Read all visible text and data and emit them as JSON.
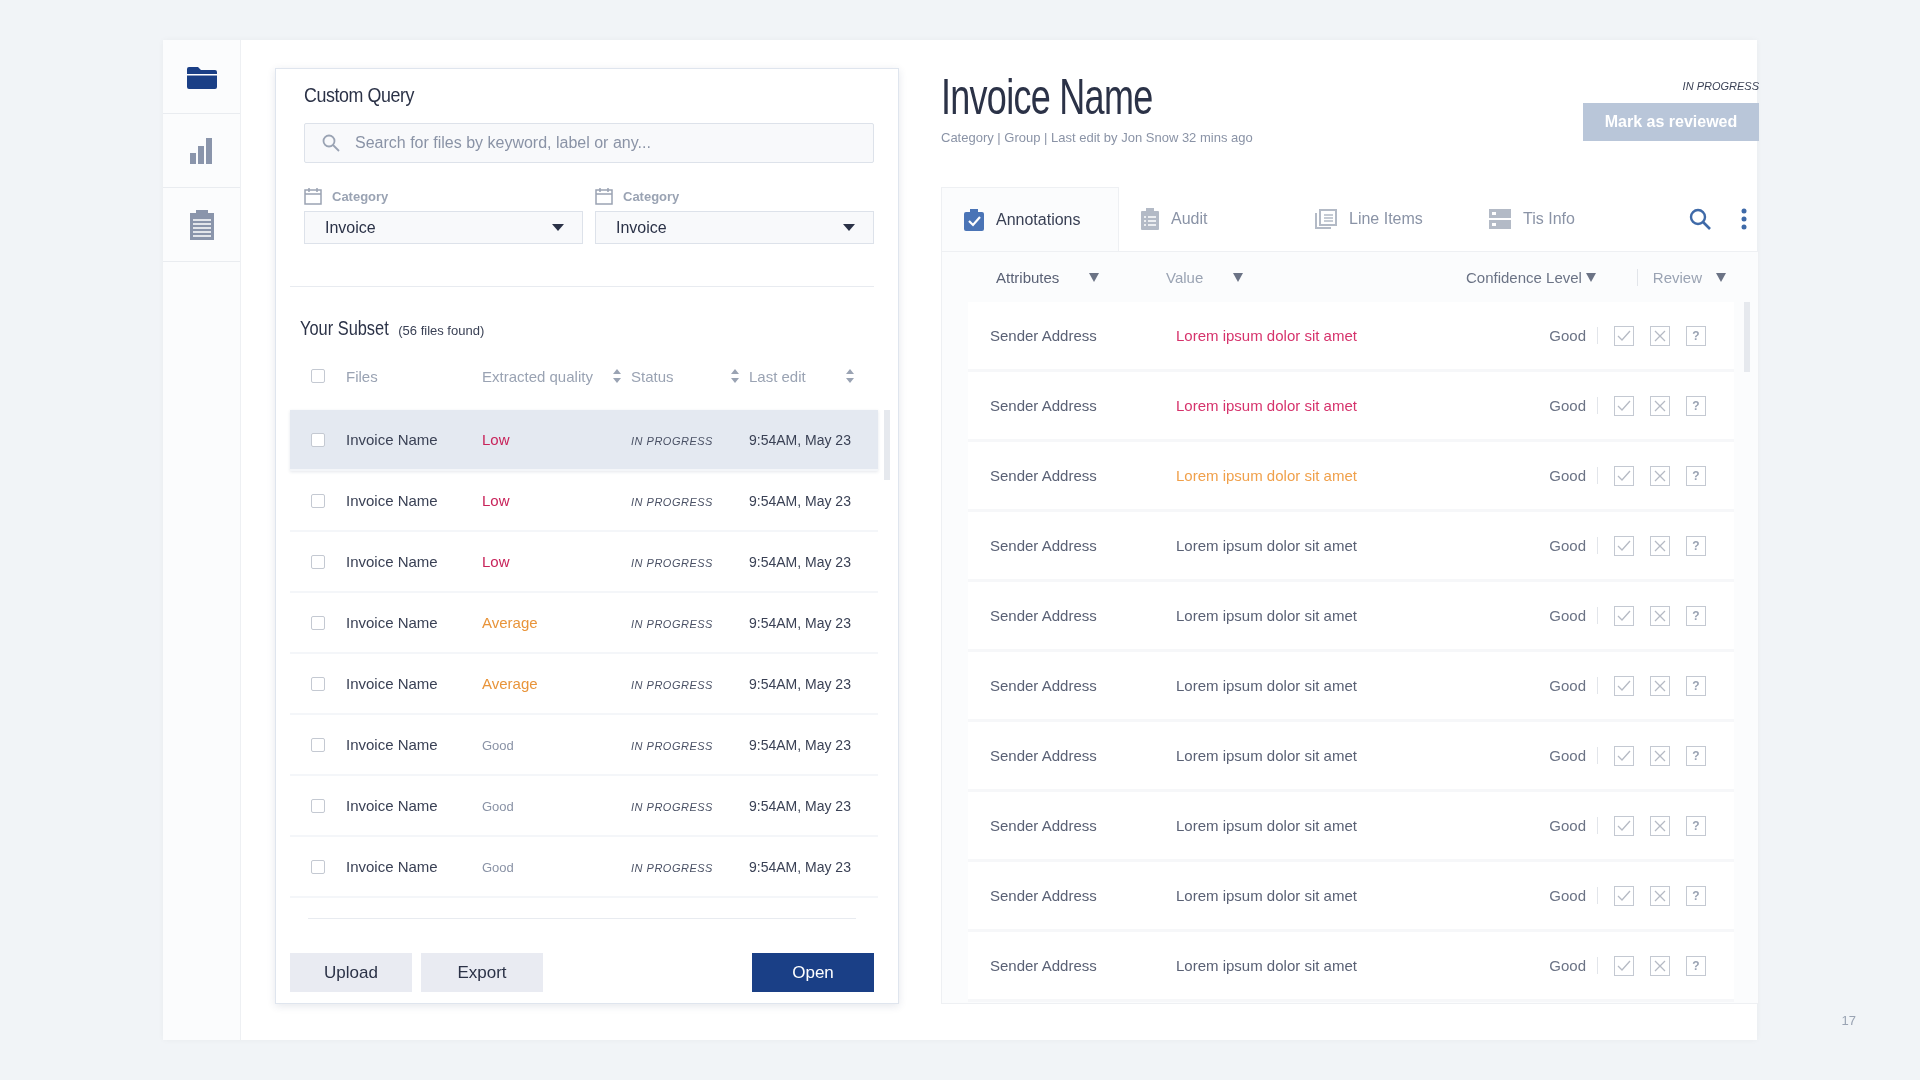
{
  "nav": [
    {
      "kind": "folder",
      "selected": true
    },
    {
      "kind": "chart",
      "selected": false
    },
    {
      "kind": "clipboard",
      "selected": false
    }
  ],
  "query": {
    "title": "Custom Query",
    "search": {
      "placeholder": "Search for files by keyword, label or any..."
    },
    "filters": [
      {
        "label": "Category",
        "value": "Invoice"
      },
      {
        "label": "Category",
        "value": "Invoice"
      }
    ]
  },
  "subset": {
    "title": "Your Subset",
    "count": "(56 files found)",
    "columns": [
      "Files",
      "Extracted quality",
      "Status",
      "Last edit"
    ],
    "select_all": {
      "checked": false
    },
    "rows": [
      {
        "name": "Invoice Name",
        "quality": "Low",
        "kind": "low",
        "status": "IN PROGRESS",
        "last_edit": "9:54AM, May 23",
        "checked": false,
        "selected": true
      },
      {
        "name": "Invoice Name",
        "quality": "Low",
        "kind": "low",
        "status": "IN PROGRESS",
        "last_edit": "9:54AM, May 23",
        "checked": false,
        "selected": false
      },
      {
        "name": "Invoice Name",
        "quality": "Low",
        "kind": "low",
        "status": "IN PROGRESS",
        "last_edit": "9:54AM, May 23",
        "checked": false,
        "selected": false
      },
      {
        "name": "Invoice Name",
        "quality": "Average",
        "kind": "average",
        "status": "IN PROGRESS",
        "last_edit": "9:54AM, May 23",
        "checked": false,
        "selected": false
      },
      {
        "name": "Invoice Name",
        "quality": "Average",
        "kind": "average",
        "status": "IN PROGRESS",
        "last_edit": "9:54AM, May 23",
        "checked": false,
        "selected": false
      },
      {
        "name": "Invoice Name",
        "quality": "Good",
        "kind": "good",
        "status": "IN PROGRESS",
        "last_edit": "9:54AM, May 23",
        "checked": false,
        "selected": false
      },
      {
        "name": "Invoice Name",
        "quality": "Good",
        "kind": "good",
        "status": "IN PROGRESS",
        "last_edit": "9:54AM, May 23",
        "checked": false,
        "selected": false
      },
      {
        "name": "Invoice Name",
        "quality": "Good",
        "kind": "good",
        "status": "IN PROGRESS",
        "last_edit": "9:54AM, May 23",
        "checked": false,
        "selected": false
      }
    ],
    "buttons": [
      {
        "label": "Upload",
        "kind": "secondary"
      },
      {
        "label": "Export",
        "kind": "secondary"
      },
      {
        "label": "Open",
        "kind": "primary"
      }
    ]
  },
  "detail": {
    "title": "Invoice Name",
    "meta": "Category | Group | Last edit by Jon Snow 32 mins ago",
    "status": "IN PROGRESS",
    "action": {
      "label": "Mark as reviewed",
      "disabled": true
    }
  },
  "tabs": [
    {
      "label": "Annotations",
      "kind": "clipboard-check",
      "selected": true
    },
    {
      "label": "Audit",
      "kind": "clipboard-list",
      "selected": false
    },
    {
      "label": "Line Items",
      "kind": "pages",
      "selected": false
    },
    {
      "label": "Tis Info",
      "kind": "server",
      "selected": false
    }
  ],
  "annotations": {
    "columns": [
      "Attributes",
      "Value",
      "Confidence Level",
      "Review"
    ],
    "rows": [
      {
        "attribute": "Sender Address",
        "value": "Lorem ipsum dolor sit amet",
        "kind": "error",
        "confidence": "Good",
        "help": "?"
      },
      {
        "attribute": "Sender Address",
        "value": "Lorem ipsum dolor sit amet",
        "kind": "error",
        "confidence": "Good",
        "help": "?"
      },
      {
        "attribute": "Sender Address",
        "value": "Lorem ipsum dolor sit amet",
        "kind": "warning",
        "confidence": "Good",
        "help": "?"
      },
      {
        "attribute": "Sender Address",
        "value": "Lorem ipsum dolor sit amet",
        "kind": "normal",
        "confidence": "Good",
        "help": "?"
      },
      {
        "attribute": "Sender Address",
        "value": "Lorem ipsum dolor sit amet",
        "kind": "normal",
        "confidence": "Good",
        "help": "?"
      },
      {
        "attribute": "Sender Address",
        "value": "Lorem ipsum dolor sit amet",
        "kind": "normal",
        "confidence": "Good",
        "help": "?"
      },
      {
        "attribute": "Sender Address",
        "value": "Lorem ipsum dolor sit amet",
        "kind": "normal",
        "confidence": "Good",
        "help": "?"
      },
      {
        "attribute": "Sender Address",
        "value": "Lorem ipsum dolor sit amet",
        "kind": "normal",
        "confidence": "Good",
        "help": "?"
      },
      {
        "attribute": "Sender Address",
        "value": "Lorem ipsum dolor sit amet",
        "kind": "normal",
        "confidence": "Good",
        "help": "?"
      },
      {
        "attribute": "Sender Address",
        "value": "Lorem ipsum dolor sit amet",
        "kind": "normal",
        "confidence": "Good",
        "help": "?"
      }
    ]
  },
  "page_number": "17"
}
